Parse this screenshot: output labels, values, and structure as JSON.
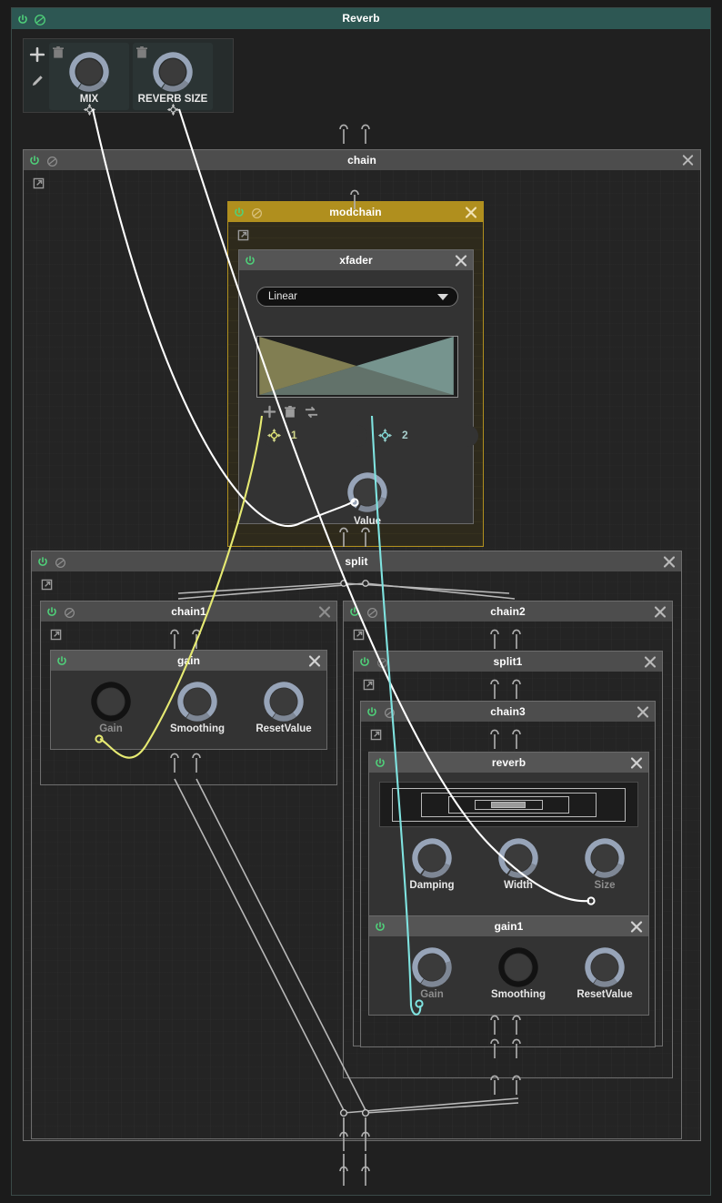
{
  "window": {
    "title": "Reverb",
    "accent_header": "#2d5753",
    "accent_gold": "#b08f1e",
    "bg": "#1b1b1b"
  },
  "toolbar": {
    "add_label": "+",
    "edit_label": "pencil",
    "icons": [
      "plus-icon",
      "pencil-icon"
    ]
  },
  "parameters": [
    {
      "name": "MIX",
      "trash": "trash-icon",
      "value": 0.58
    },
    {
      "name": "REVERB SIZE",
      "trash": "trash-icon",
      "value": 0.58
    }
  ],
  "nodes": {
    "chain": {
      "label": "chain"
    },
    "modchain": {
      "label": "modchain"
    },
    "xfader": {
      "label": "xfader"
    },
    "split": {
      "label": "split"
    },
    "chain1": {
      "label": "chain1"
    },
    "gain": {
      "label": "gain"
    },
    "chain2": {
      "label": "chain2"
    },
    "split1": {
      "label": "split1"
    },
    "chain3": {
      "label": "chain3"
    },
    "reverb": {
      "label": "reverb"
    },
    "gain1": {
      "label": "gain1"
    }
  },
  "xfader": {
    "mode_value": "Linear",
    "mode_options": [
      "Linear"
    ],
    "toolbar_icons": [
      "add-modulation-icon",
      "delete-modulation-icon",
      "swap-modulation-icon"
    ],
    "targets": [
      {
        "index": "1",
        "color": "#e6ea72"
      },
      {
        "index": "2",
        "color": "#7fe3e0"
      }
    ],
    "value_knob": {
      "label": "Value",
      "value": 0.55
    },
    "curve": {
      "series_a_color": "#8a8757",
      "series_b_color": "#4f6f74"
    }
  },
  "gain_node": {
    "knobs": [
      {
        "label": "Gain",
        "value": 0.0,
        "dim": true
      },
      {
        "label": "Smoothing",
        "value": 0.62,
        "dim": false
      },
      {
        "label": "ResetValue",
        "value": 0.62,
        "dim": false
      }
    ]
  },
  "reverb_node": {
    "knobs": [
      {
        "label": "Damping",
        "value": 0.55,
        "dim": false
      },
      {
        "label": "Width",
        "value": 0.55,
        "dim": false
      },
      {
        "label": "Size",
        "value": 0.55,
        "dim": true
      }
    ],
    "visualizer": "nested-rectangles"
  },
  "gain1_node": {
    "knobs": [
      {
        "label": "Gain",
        "value": 0.45,
        "dim": true
      },
      {
        "label": "Smoothing",
        "value": 0.0,
        "dim": false
      },
      {
        "label": "ResetValue",
        "value": 0.62,
        "dim": false
      }
    ]
  },
  "cables": [
    {
      "from": "MIX",
      "to": "gain.Gain",
      "color": "#e6ea72",
      "kind": "modulation"
    },
    {
      "from": "MIX",
      "to": "xfader.Value",
      "color": "#ffffff",
      "kind": "modulation"
    },
    {
      "from": "REVERB SIZE",
      "to": "reverb.Size",
      "color": "#ffffff",
      "kind": "modulation"
    },
    {
      "from": "xfader.target2",
      "to": "gain1.Gain",
      "color": "#7fe3e0",
      "kind": "modulation"
    },
    {
      "from": "split.out",
      "to": "chain.out",
      "color": "#bdbdbd",
      "kind": "signal"
    }
  ]
}
